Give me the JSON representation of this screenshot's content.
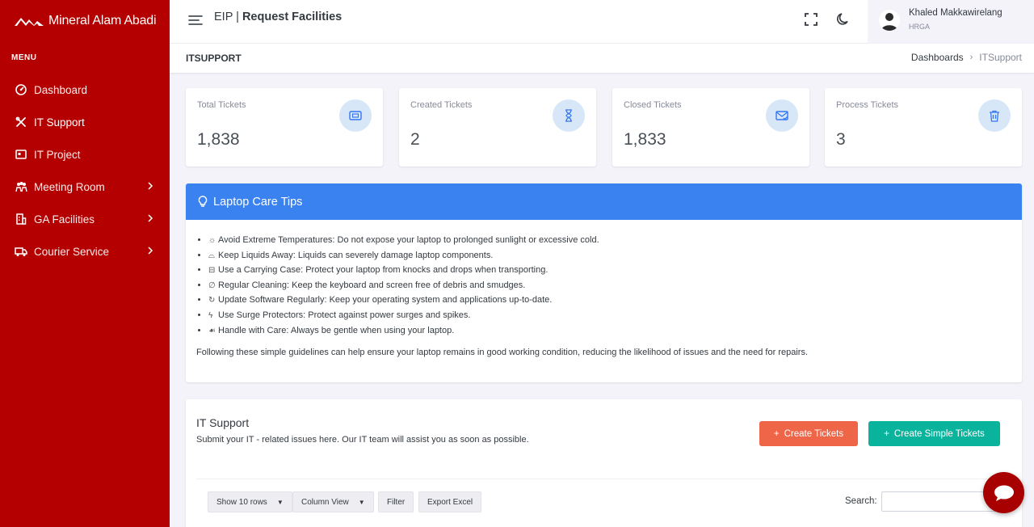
{
  "brand": {
    "name": "Mineral Alam Abadi"
  },
  "sidebar": {
    "menu_title": "MENU",
    "items": [
      {
        "label": "Dashboard",
        "icon": "dashboard-icon",
        "active": false,
        "has_children": false
      },
      {
        "label": "IT Support",
        "icon": "tools-icon",
        "active": true,
        "has_children": false
      },
      {
        "label": "IT Project",
        "icon": "project-icon",
        "active": false,
        "has_children": false
      },
      {
        "label": "Meeting Room",
        "icon": "people-icon",
        "active": false,
        "has_children": true
      },
      {
        "label": "GA Facilities",
        "icon": "building-icon",
        "active": false,
        "has_children": true
      },
      {
        "label": "Courier Service",
        "icon": "truck-icon",
        "active": false,
        "has_children": true
      }
    ]
  },
  "header": {
    "app": "EIP | ",
    "title": "Request Facilities",
    "user": {
      "name": "Khaled Makkawirelang",
      "role": "HRGA"
    }
  },
  "titlebar": {
    "title": "ITSUPPORT",
    "breadcrumb": [
      "Dashboards",
      "ITSupport"
    ]
  },
  "stats": [
    {
      "label": "Total Tickets",
      "value": "1,838",
      "icon": "ticket-icon"
    },
    {
      "label": "Created Tickets",
      "value": "2",
      "icon": "hourglass-icon"
    },
    {
      "label": "Closed Tickets",
      "value": "1,833",
      "icon": "mail-check-icon"
    },
    {
      "label": "Process Tickets",
      "value": "3",
      "icon": "trash-icon"
    }
  ],
  "tips": {
    "title": "Laptop Care Tips",
    "items": [
      {
        "icon": "☼",
        "text": "Avoid Extreme Temperatures: Do not expose your laptop to prolonged sunlight or excessive cold."
      },
      {
        "icon": "⌓",
        "text": "Keep Liquids Away: Liquids can severely damage laptop components."
      },
      {
        "icon": "⊟",
        "text": "Use a Carrying Case: Protect your laptop from knocks and drops when transporting."
      },
      {
        "icon": "∅",
        "text": "Regular Cleaning: Keep the keyboard and screen free of debris and smudges."
      },
      {
        "icon": "↻",
        "text": "Update Software Regularly: Keep your operating system and applications up-to-date."
      },
      {
        "icon": "ϟ",
        "text": "Use Surge Protectors: Protect against power surges and spikes."
      },
      {
        "icon": "☙",
        "text": "Handle with Care: Always be gentle when using your laptop."
      }
    ],
    "footer": "Following these simple guidelines can help ensure your laptop remains in good working condition, reducing the likelihood of issues and the need for repairs."
  },
  "it_support": {
    "title": "IT Support",
    "subtitle": "Submit your IT - related issues here. Our IT team will assist you as soon as possible.",
    "create_label": "Create Tickets",
    "simple_label": "Create Simple Tickets",
    "show_rows": "Show 10 rows",
    "column_view": "Column View",
    "filter": "Filter",
    "export": "Export Excel",
    "search_label": "Search:",
    "search_value": ""
  },
  "colors": {
    "sidebar": "#b40000",
    "tips_header": "#3b82f1",
    "create_button": "#ef6547",
    "simple_button": "#0ab39c",
    "stat_icon_bg": "#d7e7f8"
  }
}
